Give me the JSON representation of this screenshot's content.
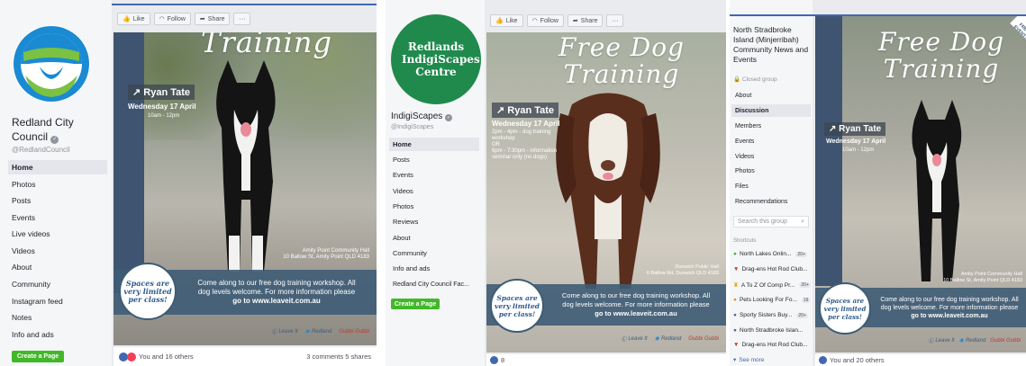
{
  "panel1": {
    "page_name": "Redland City Council",
    "handle": "@RedlandCouncil",
    "nav": [
      "Home",
      "Photos",
      "Posts",
      "Events",
      "Live videos",
      "Videos",
      "About",
      "Community",
      "Instagram feed",
      "Notes",
      "Info and ads"
    ],
    "create_page": "Create a Page",
    "actions": {
      "like": "Like",
      "follow": "Follow",
      "share": "Share",
      "more": "···"
    },
    "poster": {
      "title": "Training",
      "trainer": "Ryan Tate",
      "date": "Wednesday 17 April",
      "time": "10am - 12pm",
      "venue_line1": "Amity Point Community Hall",
      "venue_line2": "10 Ballow St, Amity Point QLD 4183",
      "spaces": "Spaces are very limited per class!",
      "info_line1": "Come along to our free dog training workshop. All",
      "info_line2": "dog levels welcome. For more information please",
      "info_line3": "go to www.leaveit.com.au",
      "logo1": "Leave It",
      "logo2": "Redland",
      "logo3": "Gubbi Gubbi"
    },
    "reactions": "You and 16 others",
    "comments_shares": "3 comments  5 shares"
  },
  "panel2": {
    "logo_text": "Redlands IndigiScapes Centre",
    "page_name": "IndigiScapes",
    "handle": "@IndigiScapes",
    "nav": [
      "Home",
      "Posts",
      "Events",
      "Videos",
      "Photos",
      "Reviews",
      "About",
      "Community",
      "Info and ads",
      "Redland City Council Fac..."
    ],
    "create_page": "Create a Page",
    "actions": {
      "like": "Like",
      "follow": "Follow",
      "share": "Share",
      "more": "···"
    },
    "poster": {
      "title_line1": "Free Dog",
      "title_line2": "Training",
      "trainer": "Ryan Tate",
      "date": "Wednesday 17 April",
      "time1": "2pm - 4pm - dog training",
      "time1b": "workshop",
      "or": "OR",
      "time2": "6pm - 7:30pm - information",
      "time2b": "seminar only (no dogs)",
      "venue_line1": "Dunwich Public Hall",
      "venue_line2": "6 Ballow Rd, Dunwich QLD 4183",
      "spaces": "Spaces are very limited per class!",
      "info_line1": "Come along to our free dog training workshop. All",
      "info_line2": "dog levels welcome. For more information please",
      "info_line3": "go to www.leaveit.com.au",
      "logo1": "Leave It",
      "logo2": "Redland",
      "logo3": "Gubbi Gubbi"
    },
    "reactions": "8"
  },
  "panel3": {
    "group_name": "North Stradbroke Island (Minjerribah) Community News and Events",
    "group_type": "Closed group",
    "nav": [
      "About",
      "Discussion",
      "Members",
      "Events",
      "Videos",
      "Photos",
      "Files",
      "Recommendations"
    ],
    "search_placeholder": "Search this group",
    "shortcuts_header": "Shortcuts",
    "shortcuts": [
      {
        "label": "North Lakes Onlin...",
        "badge": "20+"
      },
      {
        "label": "Drag-ens Hot Rod Club...",
        "badge": ""
      },
      {
        "label": "A To Z Of Comp Pr...",
        "badge": "20+"
      },
      {
        "label": "Pets Looking For Fo...",
        "badge": "19"
      },
      {
        "label": "Sporty Sisters Buy...",
        "badge": "20+"
      },
      {
        "label": "North Stradbroke Islan...",
        "badge": ""
      },
      {
        "label": "Drag-ens Hot Rod Club...",
        "badge": ""
      }
    ],
    "see_more": "See more",
    "poster": {
      "corner": "FREE EVENT!",
      "title_line1": "Free Dog",
      "title_line2": "Training",
      "trainer": "Ryan Tate",
      "date": "Wednesday 17 April",
      "time": "10am - 12pm",
      "venue_line1": "Amity Point Community Hall",
      "venue_line2": "10 Ballow St, Amity Point QLD 4183",
      "spaces": "Spaces are very limited per class!",
      "info_line1": "Come along to our free dog training workshop. All",
      "info_line2": "dog levels welcome. For more information please",
      "info_line3": "go to www.leaveit.com.au",
      "logo1": "Leave It",
      "logo2": "Redland",
      "logo3": "Gubbi Gubbi"
    },
    "reactions": "You and 20 others"
  },
  "colors": {
    "fb_blue": "#4267b2",
    "green_button": "#42b72a",
    "info_band": "#3e5c76",
    "sidebar_bg": "#f5f6f7"
  }
}
